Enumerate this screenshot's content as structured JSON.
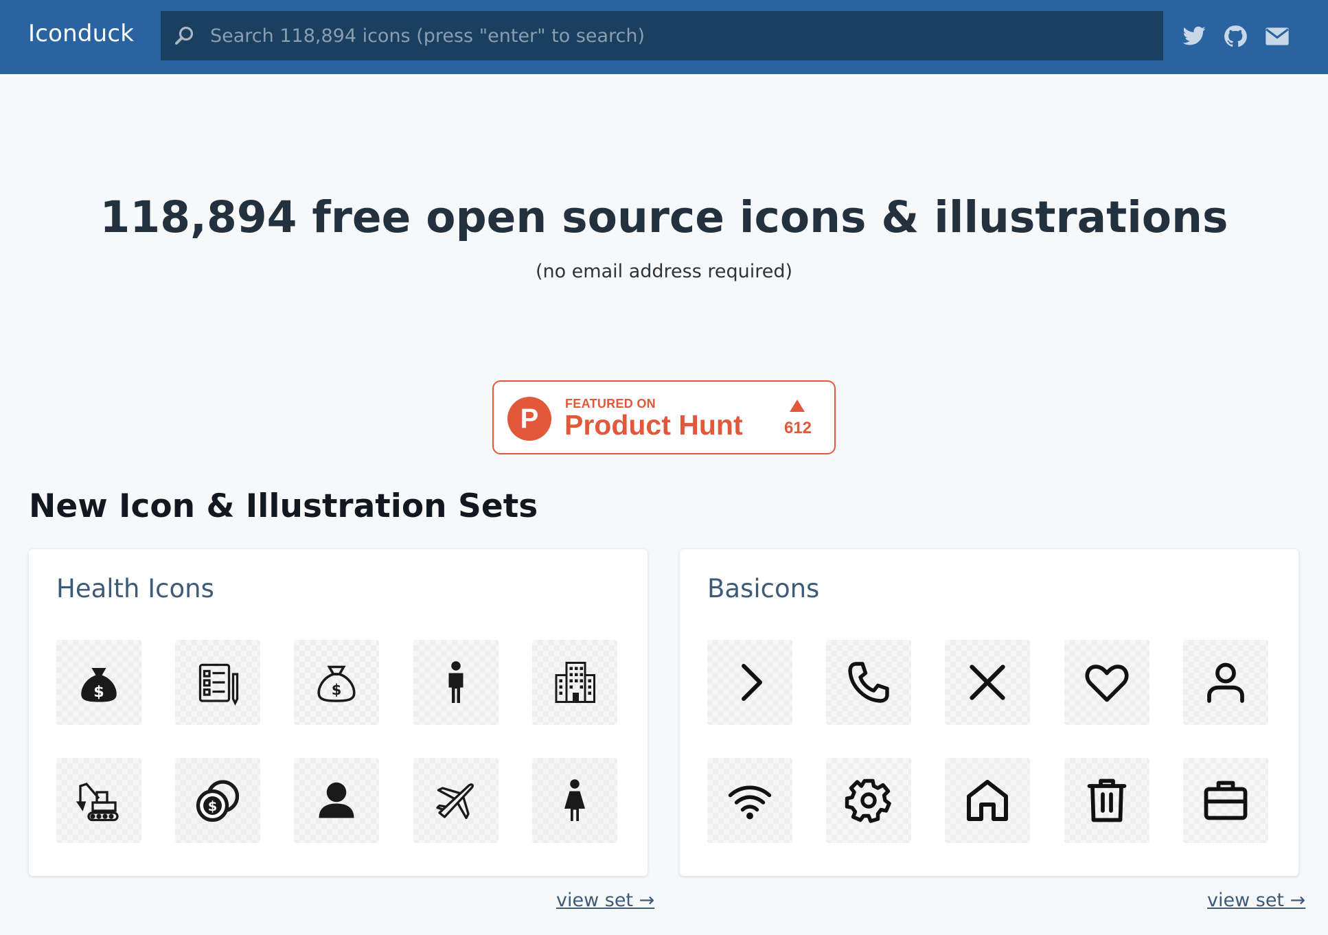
{
  "header": {
    "brand": "Iconduck",
    "search_placeholder": "Search 118,894 icons (press \"enter\" to search)",
    "social_icons": [
      "twitter-icon",
      "github-icon",
      "mail-icon"
    ]
  },
  "hero": {
    "title": "118,894 free open source icons & illustrations",
    "subtitle": "(no email address required)"
  },
  "product_hunt": {
    "logo_letter": "P",
    "featured": "FEATURED ON",
    "name": "Product Hunt",
    "count": "612"
  },
  "sets_section": {
    "title": "New Icon & Illustration Sets",
    "cards": [
      {
        "title": "Health Icons",
        "link": "view set →",
        "icons": [
          "money-bag-icon",
          "checklist-pencil-icon",
          "money-bag-outline-icon",
          "man-icon",
          "building-icon",
          "excavator-icon",
          "coins-icon",
          "person-icon",
          "airplane-icon",
          "woman-icon"
        ]
      },
      {
        "title": "Basicons",
        "link": "view set →",
        "icons": [
          "chevron-right-icon",
          "phone-icon",
          "close-icon",
          "heart-icon",
          "user-icon",
          "wifi-icon",
          "gear-icon",
          "home-icon",
          "trash-icon",
          "briefcase-icon"
        ]
      }
    ]
  },
  "colors": {
    "header_bg": "#2a64a0",
    "search_bg": "#1a3f5f",
    "accent": "#e2583a",
    "card_title": "#3d5a78",
    "page_bg": "#f7f8fa"
  }
}
